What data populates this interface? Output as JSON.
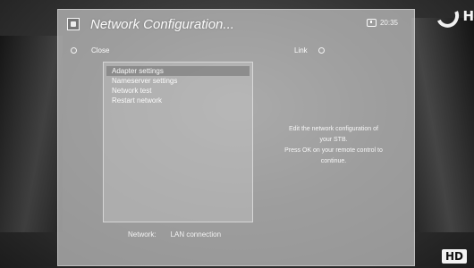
{
  "window": {
    "title": "Network Configuration...",
    "time": "20:35"
  },
  "actions": {
    "close_label": "Close",
    "link_label": "Link"
  },
  "menu": {
    "items": [
      {
        "label": "Adapter settings"
      },
      {
        "label": "Nameserver settings"
      },
      {
        "label": "Network test"
      },
      {
        "label": "Restart network"
      }
    ],
    "selected_index": 0
  },
  "help_text": {
    "line1": "Edit the network configuration of",
    "line2": "your STB.",
    "line3": "Press OK on your remote control to",
    "line4": "continue."
  },
  "status": {
    "label": "Network:",
    "value": "LAN connection"
  },
  "overlay": {
    "hd_badge": "HD",
    "channel_logo_letter": "H"
  }
}
